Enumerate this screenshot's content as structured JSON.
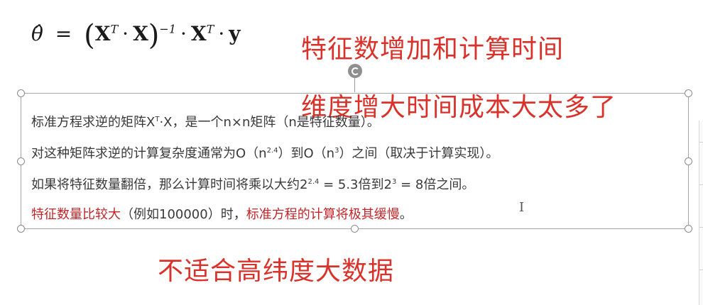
{
  "formula": {
    "theta": "θ̂",
    "equals": "=",
    "X": "X",
    "T": "T",
    "inv": "−1",
    "dot": "·",
    "y": "y"
  },
  "notes": {
    "note1": "特征数增加和计算时间",
    "note2": "维度增大时间成本大太多了",
    "note3": "不适合高纬度大数据"
  },
  "textbox": {
    "line1_a": "标准方程求逆的矩阵X",
    "line1_sup": "T",
    "line1_b": "·X，是一个n×n矩阵（n是特征数量）。",
    "line2_a": "对这种矩阵求逆的计算复杂度通常为O（n",
    "line2_sup1": "2.4",
    "line2_b": "）到O（n",
    "line2_sup2": "3",
    "line2_c": "）之间（取决于计算实现）。",
    "line3_a": "如果将特征数量翻倍，那么计算时间将乘以大约2",
    "line3_sup1": "2.4",
    "line3_b": " = 5.3倍到2",
    "line3_sup2": "3",
    "line3_c": " = 8倍之间。",
    "line4_hl1": "特征数量比较大",
    "line4_mid": "（例如100000）时，",
    "line4_hl2": "标准方程的计算将极其缓慢",
    "line4_end": "。"
  },
  "cursor": "I",
  "colors": {
    "note_red": "#d9322b",
    "highlight_red": "#c0262a",
    "body_text": "#3a3a3a"
  },
  "icons": {
    "rotate": "rotate-handle-icon",
    "cursor": "text-cursor-icon"
  }
}
